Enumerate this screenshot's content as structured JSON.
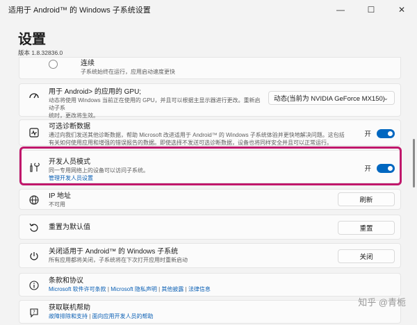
{
  "window": {
    "title": "适用于 Android™ 的 Windows 子系统设置",
    "minimize": "—",
    "maximize": "☐",
    "close": "✕"
  },
  "header": {
    "title": "设置",
    "version": "版本 1.8.32836.0"
  },
  "continuous": {
    "title": "连续",
    "desc": "子系统始终在运行，应用启动速度更快"
  },
  "gpu": {
    "title": "用于 Android> 的应用的 GPU;",
    "desc1": "动态将使用 Windows 当前正在使用的 GPU，并且可以根据主显示器进行更改。重新启动子系",
    "desc2": "统时，更改将生效。",
    "dropdown_value": "动态(当前为 NVIDIA GeForce MX150)",
    "icon": "gpu-gauge-icon"
  },
  "diagnostics": {
    "title": "可选诊断数据",
    "desc1": "通过向我们发送其他诊断数据，帮助 Microsoft 改进适用于 Android™ 的 Windows 子系统体验并更快地解决问题。这包括",
    "desc2": "有关如何使用应用和增强的错误报告的数据。即使选择不发送可选诊断数据，设备也将同样安全并且可以正常运行。",
    "toggle_label": "开",
    "toggle_on": true,
    "icon": "diagnostics-icon"
  },
  "developer": {
    "title": "开发人员模式",
    "desc": "同一专用网络上的设备可以访问子系统。",
    "link": "管理开发人员设置",
    "toggle_label": "开",
    "toggle_on": true,
    "icon": "developer-tools-icon",
    "highlight_color": "#c0176b"
  },
  "ip": {
    "title": "IP 地址",
    "desc": "不可用",
    "button": "刷新",
    "icon": "globe-network-icon"
  },
  "reset": {
    "title": "重置为默认值",
    "button": "重置",
    "icon": "reset-icon"
  },
  "shutdown": {
    "title": "关闭适用于 Android™ 的 Windows 子系统",
    "desc": "所有应用都将关闭，子系统将在下次打开应用时重新启动",
    "button": "关闭",
    "icon": "power-icon"
  },
  "terms": {
    "title": "条款和协议",
    "links": [
      "Microsoft 软件许可条款",
      "Microsoft 隐私声明",
      "其他披露",
      "法律信息"
    ],
    "separator": " | ",
    "icon": "info-icon"
  },
  "help": {
    "title": "获取联机帮助",
    "links": [
      "故障排除和支持",
      "面向应用开发人员的帮助"
    ],
    "separator": " | ",
    "icon": "help-icon"
  },
  "watermark": "知乎 @青栀",
  "colors": {
    "accent": "#0067c0",
    "link": "#0a5fb4",
    "background": "#f3f3f3"
  }
}
